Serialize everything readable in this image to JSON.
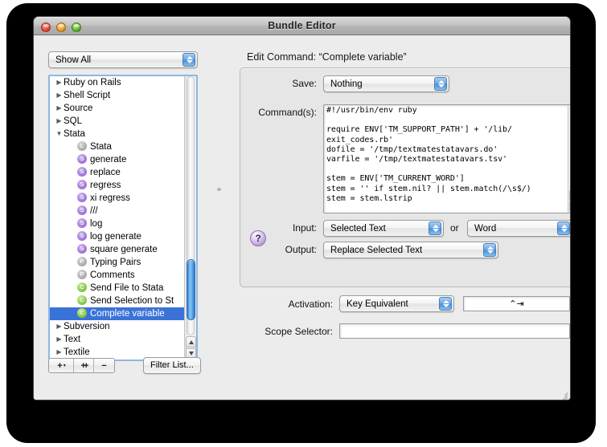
{
  "window": {
    "title": "Bundle Editor",
    "traffic": {
      "close": "close-button",
      "minimize": "minimize-button",
      "zoom": "zoom-button"
    }
  },
  "sidebar": {
    "filter_popup": {
      "value": "Show All"
    },
    "tree": [
      {
        "label": "Ruby on Rails",
        "level": 1,
        "twisty": "right",
        "icon": null,
        "selected": false
      },
      {
        "label": "Shell Script",
        "level": 1,
        "twisty": "right",
        "icon": null,
        "selected": false
      },
      {
        "label": "Source",
        "level": 1,
        "twisty": "right",
        "icon": null,
        "selected": false
      },
      {
        "label": "SQL",
        "level": 1,
        "twisty": "right",
        "icon": null,
        "selected": false
      },
      {
        "label": "Stata",
        "level": 1,
        "twisty": "down",
        "icon": null,
        "selected": false
      },
      {
        "label": "Stata",
        "level": 2,
        "twisty": "none",
        "icon": "L",
        "selected": false
      },
      {
        "label": "generate",
        "level": 2,
        "twisty": "none",
        "icon": "S",
        "selected": false
      },
      {
        "label": "replace",
        "level": 2,
        "twisty": "none",
        "icon": "S",
        "selected": false
      },
      {
        "label": "regress",
        "level": 2,
        "twisty": "none",
        "icon": "S",
        "selected": false
      },
      {
        "label": "xi regress",
        "level": 2,
        "twisty": "none",
        "icon": "S",
        "selected": false
      },
      {
        "label": "///",
        "level": 2,
        "twisty": "none",
        "icon": "S",
        "selected": false
      },
      {
        "label": "log",
        "level": 2,
        "twisty": "none",
        "icon": "S",
        "selected": false
      },
      {
        "label": "log generate",
        "level": 2,
        "twisty": "none",
        "icon": "S",
        "selected": false
      },
      {
        "label": "square generate",
        "level": 2,
        "twisty": "none",
        "icon": "S",
        "selected": false
      },
      {
        "label": "Typing Pairs",
        "level": 2,
        "twisty": "none",
        "icon": "P",
        "selected": false
      },
      {
        "label": "Comments",
        "level": 2,
        "twisty": "none",
        "icon": "P",
        "selected": false
      },
      {
        "label": "Send File to Stata",
        "level": 2,
        "twisty": "none",
        "icon": "C",
        "selected": false
      },
      {
        "label": "Send Selection to St",
        "level": 2,
        "twisty": "none",
        "icon": "C",
        "selected": false
      },
      {
        "label": "Complete variable",
        "level": 2,
        "twisty": "none",
        "icon": "C",
        "selected": true
      },
      {
        "label": "Subversion",
        "level": 1,
        "twisty": "right",
        "icon": null,
        "selected": false
      },
      {
        "label": "Text",
        "level": 1,
        "twisty": "right",
        "icon": null,
        "selected": false
      },
      {
        "label": "Textile",
        "level": 1,
        "twisty": "right",
        "icon": null,
        "selected": false
      }
    ],
    "toolbar": {
      "add_label": "+",
      "add_menu_caret": "▾",
      "duplicate_label": "+ +",
      "remove_label": "−",
      "filter_list_label": "Filter List..."
    }
  },
  "editor": {
    "heading": "Edit Command: “Complete variable”",
    "save": {
      "label": "Save:",
      "value": "Nothing"
    },
    "commands": {
      "label": "Command(s):",
      "code": "#!/usr/bin/env ruby\n\nrequire ENV['TM_SUPPORT_PATH'] + '/lib/\nexit_codes.rb'\ndofile = '/tmp/textmatestatavars.do'\nvarfile = '/tmp/textmatestatavars.tsv'\n\nstem = ENV['TM_CURRENT_WORD']\nstem = '' if stem.nil? || stem.match(/\\s$/)\nstem = stem.lstrip"
    },
    "input": {
      "label": "Input:",
      "value": "Selected Text",
      "conjunction": "or",
      "fallback_value": "Word"
    },
    "output": {
      "label": "Output:",
      "value": "Replace Selected Text"
    },
    "help": {
      "glyph": "?"
    },
    "activation": {
      "label": "Activation:",
      "value": "Key Equivalent",
      "key_equivalent": "⌃⇥"
    },
    "scope": {
      "label": "Scope Selector:",
      "value": "",
      "placeholder": ""
    }
  },
  "colors": {
    "selection_blue": "#3a73d8",
    "focus_ring": "#8fb7e0",
    "snippet_purple": "#a97fe0",
    "command_green": "#8ccf4e",
    "preference_gray": "#b4b4b4",
    "window_bg": "#ececec"
  }
}
